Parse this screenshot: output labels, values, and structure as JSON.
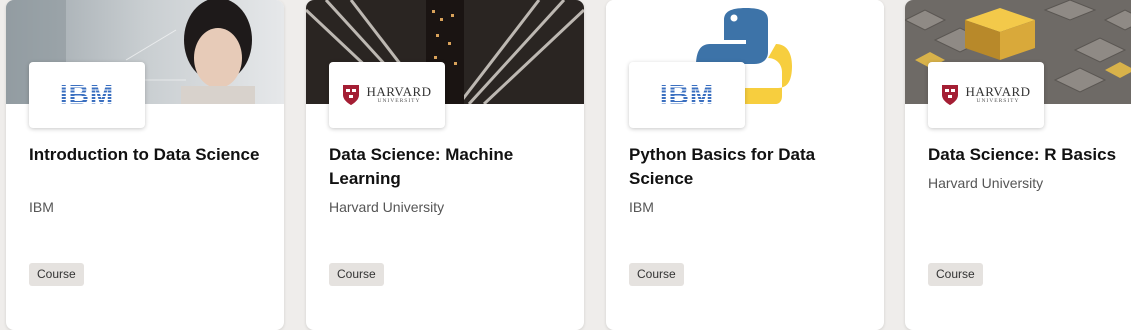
{
  "cards": [
    {
      "logo": "IBM",
      "logo_type": "ibm",
      "title": "Introduction to Data Science",
      "provider": "IBM",
      "badge": "Course"
    },
    {
      "logo": "HARVARD",
      "logo_sub": "UNIVERSITY",
      "logo_type": "harvard",
      "title": "Data Science: Machine Learning",
      "provider": "Harvard University",
      "badge": "Course"
    },
    {
      "logo": "IBM",
      "logo_type": "ibm",
      "title": "Python Basics for Data Science",
      "provider": "IBM",
      "badge": "Course"
    },
    {
      "logo": "HARVARD",
      "logo_sub": "UNIVERSITY",
      "logo_type": "harvard",
      "title": "Data Science: R Basics",
      "provider": "Harvard University",
      "badge": "Course"
    }
  ],
  "colors": {
    "page_bg": "#efedeb",
    "ibm_blue": "#3a6fc0",
    "harvard_crimson": "#a41e34",
    "badge_bg": "#e5e2df"
  },
  "icons": [
    "python-logo-icon",
    "harvard-shield-icon"
  ]
}
